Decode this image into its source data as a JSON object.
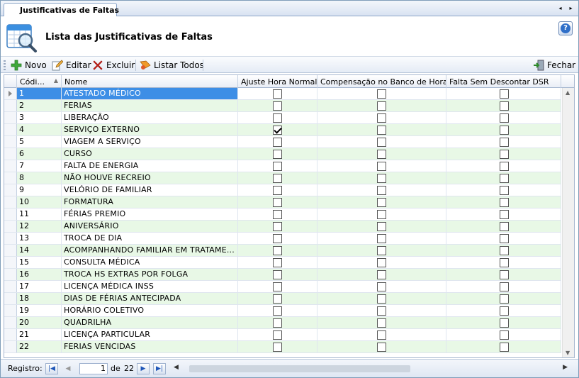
{
  "tab": {
    "label": "Justificativas de Faltas",
    "nav_prev": "◂",
    "nav_next": "▸"
  },
  "header": {
    "title": "Lista das Justificativas de Faltas",
    "help": "?"
  },
  "toolbar": {
    "new": "Novo",
    "edit": "Editar",
    "delete": "Excluir",
    "list_all": "Listar Todos",
    "close": "Fechar"
  },
  "grid": {
    "columns": {
      "code": "Códi...",
      "name": "Nome",
      "adjust": "Ajuste Hora Normal",
      "compensation": "Compensação no Banco de Horas",
      "absence": "Falta Sem Descontar DSR"
    },
    "rows": [
      {
        "code": "1",
        "name": "ATESTADO MÉDICO",
        "adjust": false,
        "compensation": false,
        "absence": false
      },
      {
        "code": "2",
        "name": "FERIAS",
        "adjust": false,
        "compensation": false,
        "absence": false
      },
      {
        "code": "3",
        "name": "LIBERAÇÃO",
        "adjust": false,
        "compensation": false,
        "absence": false
      },
      {
        "code": "4",
        "name": "SERVIÇO EXTERNO",
        "adjust": true,
        "compensation": false,
        "absence": false
      },
      {
        "code": "5",
        "name": "VIAGEM A SERVIÇO",
        "adjust": false,
        "compensation": false,
        "absence": false
      },
      {
        "code": "6",
        "name": "CURSO",
        "adjust": false,
        "compensation": false,
        "absence": false
      },
      {
        "code": "7",
        "name": "FALTA DE ENERGIA",
        "adjust": false,
        "compensation": false,
        "absence": false
      },
      {
        "code": "8",
        "name": "NÃO HOUVE RECREIO",
        "adjust": false,
        "compensation": false,
        "absence": false
      },
      {
        "code": "9",
        "name": "VELÓRIO DE FAMILIAR",
        "adjust": false,
        "compensation": false,
        "absence": false
      },
      {
        "code": "10",
        "name": "FORMATURA",
        "adjust": false,
        "compensation": false,
        "absence": false
      },
      {
        "code": "11",
        "name": "FÉRIAS PREMIO",
        "adjust": false,
        "compensation": false,
        "absence": false
      },
      {
        "code": "12",
        "name": "ANIVERSÁRIO",
        "adjust": false,
        "compensation": false,
        "absence": false
      },
      {
        "code": "13",
        "name": "TROCA DE DIA",
        "adjust": false,
        "compensation": false,
        "absence": false
      },
      {
        "code": "14",
        "name": "ACOMPANHANDO FAMILIAR EM TRATAME...",
        "adjust": false,
        "compensation": false,
        "absence": false
      },
      {
        "code": "15",
        "name": "CONSULTA MÉDICA",
        "adjust": false,
        "compensation": false,
        "absence": false
      },
      {
        "code": "16",
        "name": "TROCA HS EXTRAS POR FOLGA",
        "adjust": false,
        "compensation": false,
        "absence": false
      },
      {
        "code": "17",
        "name": "LICENÇA MÉDICA INSS",
        "adjust": false,
        "compensation": false,
        "absence": false
      },
      {
        "code": "18",
        "name": "DIAS DE FÉRIAS ANTECIPADA",
        "adjust": false,
        "compensation": false,
        "absence": false
      },
      {
        "code": "19",
        "name": "HORÁRIO COLETIVO",
        "adjust": false,
        "compensation": false,
        "absence": false
      },
      {
        "code": "20",
        "name": "QUADRILHA",
        "adjust": false,
        "compensation": false,
        "absence": false
      },
      {
        "code": "21",
        "name": "LICENÇA PARTICULAR",
        "adjust": false,
        "compensation": false,
        "absence": false
      },
      {
        "code": "22",
        "name": "FERIAS VENCIDAS",
        "adjust": false,
        "compensation": false,
        "absence": false
      }
    ]
  },
  "footer": {
    "record_label": "Registro:",
    "current_page": "1",
    "of_label": "de",
    "total": "22"
  },
  "colors": {
    "selected": "#3d8ee6",
    "alt_row": "#e8f8e6",
    "border": "#7f9db9"
  }
}
